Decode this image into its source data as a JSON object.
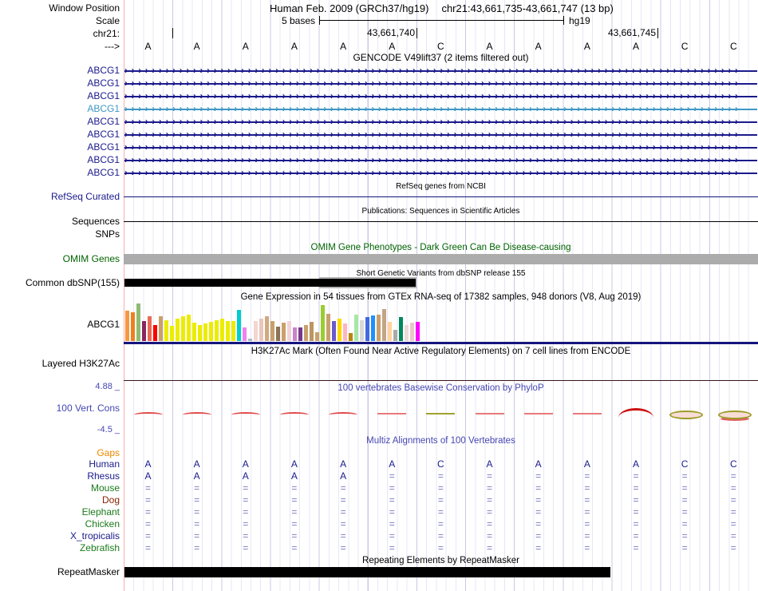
{
  "header": {
    "window_position_label": "Window Position",
    "assembly_title": "Human Feb. 2009 (GRCh37/hg19)",
    "range_title": "chr21:43,661,735-43,661,747 (13 bp)",
    "scale_label": "Scale",
    "scale_value": "5 bases",
    "assembly_tag": "hg19",
    "chrom_label": "chr21:",
    "coord_label_1": "43,661,740",
    "coord_label_2": "43,661,745",
    "strand_label": "--->"
  },
  "sequence": {
    "bases": [
      "A",
      "A",
      "A",
      "A",
      "A",
      "A",
      "C",
      "A",
      "A",
      "A",
      "A",
      "C",
      "C"
    ]
  },
  "gencode": {
    "title": "GENCODE V49lift37 (2 items filtered out)",
    "gene_rows": [
      {
        "label": "ABCG1",
        "color": "#1A1A8C"
      },
      {
        "label": "ABCG1",
        "color": "#1A1A8C"
      },
      {
        "label": "ABCG1",
        "color": "#1A1A8C"
      },
      {
        "label": "ABCG1",
        "color": "#3E97C5"
      },
      {
        "label": "ABCG1",
        "color": "#1A1A8C"
      },
      {
        "label": "ABCG1",
        "color": "#1A1A8C"
      },
      {
        "label": "ABCG1",
        "color": "#1A1A8C"
      },
      {
        "label": "ABCG1",
        "color": "#1A1A8C"
      },
      {
        "label": "ABCG1",
        "color": "#1A1A8C"
      }
    ]
  },
  "refseq": {
    "title": "RefSeq genes from NCBI",
    "label": "RefSeq Curated"
  },
  "publications": {
    "title": "Publications: Sequences in Scientific Articles",
    "label": "Sequences"
  },
  "snps": {
    "label": "SNPs"
  },
  "omim": {
    "title": "OMIM Gene Phenotypes - Dark Green Can Be Disease-causing",
    "label": "OMIM Genes"
  },
  "dbsnp": {
    "title": "Short Genetic Variants from dbSNP release 155",
    "label": "Common dbSNP(155)"
  },
  "gtex": {
    "label": "ABCG1"
  },
  "h3k27ac": {
    "title": "H3K27Ac Mark (Often Found Near Active Regulatory Elements) on 7 cell lines from ENCODE",
    "label": "Layered H3K27Ac"
  },
  "conservation": {
    "title": "100 vertebrates Basewise Conservation by PhyloP",
    "label": "100 Vert. Cons",
    "max_label": "4.88 _",
    "min_label": "-4.5 _",
    "marks": [
      {
        "base": 0,
        "type": "wave"
      },
      {
        "base": 1,
        "type": "wave"
      },
      {
        "base": 2,
        "type": "wave"
      },
      {
        "base": 3,
        "type": "wave"
      },
      {
        "base": 4,
        "type": "wave"
      },
      {
        "base": 5,
        "type": "line-red"
      },
      {
        "base": 6,
        "type": "line-olive"
      },
      {
        "base": 7,
        "type": "line-red"
      },
      {
        "base": 8,
        "type": "line-red"
      },
      {
        "base": 9,
        "type": "line-red"
      },
      {
        "base": 10,
        "type": "peak-red"
      },
      {
        "base": 11,
        "type": "ellipse-olive"
      },
      {
        "base": 12,
        "type": "ellipse-olive-red"
      }
    ]
  },
  "multiz": {
    "title": "Multiz Alignments of 100 Vertebrates",
    "gaps_label": "Gaps",
    "species": [
      {
        "name": "Human",
        "color": "#1A1A8C",
        "cells": [
          "A",
          "A",
          "A",
          "A",
          "A",
          "A",
          "C",
          "A",
          "A",
          "A",
          "A",
          "C",
          "C"
        ]
      },
      {
        "name": "Rhesus",
        "color": "#1A1A8C",
        "cells": [
          "A",
          "A",
          "A",
          "A",
          "A",
          "=",
          "=",
          "=",
          "=",
          "=",
          "=",
          "=",
          "="
        ]
      },
      {
        "name": "Mouse",
        "color": "#1A7A1A",
        "cells": [
          "=",
          "=",
          "=",
          "=",
          "=",
          "=",
          "=",
          "=",
          "=",
          "=",
          "=",
          "=",
          "="
        ]
      },
      {
        "name": "Dog",
        "color": "#8B2200",
        "cells": [
          "=",
          "=",
          "=",
          "=",
          "=",
          "=",
          "=",
          "=",
          "=",
          "=",
          "=",
          "=",
          "="
        ]
      },
      {
        "name": "Elephant",
        "color": "#1A7A1A",
        "cells": [
          "=",
          "=",
          "=",
          "=",
          "=",
          "=",
          "=",
          "=",
          "=",
          "=",
          "=",
          "=",
          "="
        ]
      },
      {
        "name": "Chicken",
        "color": "#1A7A1A",
        "cells": [
          "=",
          "=",
          "=",
          "=",
          "=",
          "=",
          "=",
          "=",
          "=",
          "=",
          "=",
          "=",
          "="
        ]
      },
      {
        "name": "X_tropicalis",
        "color": "#1A1A8C",
        "cells": [
          "=",
          "=",
          "=",
          "=",
          "=",
          "=",
          "=",
          "=",
          "=",
          "=",
          "=",
          "=",
          "="
        ]
      },
      {
        "name": "Zebrafish",
        "color": "#1A7A1A",
        "cells": [
          "=",
          "=",
          "=",
          "=",
          "=",
          "=",
          "=",
          "=",
          "=",
          "=",
          "=",
          "=",
          "="
        ]
      }
    ]
  },
  "repeatmasker": {
    "title": "Repeating Elements by RepeatMasker",
    "label": "RepeatMasker"
  },
  "chart_data": {
    "type": "bar",
    "title": "Gene Expression in 54 tissues from GTEx RNA-seq of 17382 samples, 948 donors (V8, Aug 2019)",
    "gene_label": "ABCG1",
    "xlabel": "",
    "ylabel": "",
    "ylim": [
      0,
      47
    ],
    "bars": [
      {
        "h": 38,
        "color": "#F79840"
      },
      {
        "h": 36,
        "color": "#EE8020"
      },
      {
        "h": 47,
        "color": "#8FBC73"
      },
      {
        "h": 25,
        "color": "#8B2560"
      },
      {
        "h": 31,
        "color": "#E96A55"
      },
      {
        "h": 20,
        "color": "#FF0000"
      },
      {
        "h": 31,
        "color": "#C9A06C"
      },
      {
        "h": 26,
        "color": "#ECEC00"
      },
      {
        "h": 19,
        "color": "#ECEC00"
      },
      {
        "h": 28,
        "color": "#ECEC00"
      },
      {
        "h": 31,
        "color": "#ECEC00"
      },
      {
        "h": 33,
        "color": "#ECEC00"
      },
      {
        "h": 23,
        "color": "#ECEC00"
      },
      {
        "h": 20,
        "color": "#ECEC00"
      },
      {
        "h": 22,
        "color": "#ECEC00"
      },
      {
        "h": 24,
        "color": "#ECEC00"
      },
      {
        "h": 26,
        "color": "#ECEC00"
      },
      {
        "h": 28,
        "color": "#ECEC00"
      },
      {
        "h": 25,
        "color": "#ECEC00"
      },
      {
        "h": 25,
        "color": "#ECEC00"
      },
      {
        "h": 39,
        "color": "#00CDCD"
      },
      {
        "h": 17,
        "color": "#EE82EE"
      },
      {
        "h": 3,
        "color": "#A8B8C8"
      },
      {
        "h": 25,
        "color": "#F2D6CF"
      },
      {
        "h": 28,
        "color": "#EAC5BC"
      },
      {
        "h": 31,
        "color": "#D0A97E"
      },
      {
        "h": 25,
        "color": "#C9A06C"
      },
      {
        "h": 18,
        "color": "#8B7355"
      },
      {
        "h": 23,
        "color": "#C9A06C"
      },
      {
        "h": 25,
        "color": "#F0D4DA"
      },
      {
        "h": 17,
        "color": "#C884C8"
      },
      {
        "h": 17,
        "color": "#7A378B"
      },
      {
        "h": 20,
        "color": "#C9A06C"
      },
      {
        "h": 24,
        "color": "#BE9460"
      },
      {
        "h": 11,
        "color": "#C9A06C"
      },
      {
        "h": 45,
        "color": "#9ACD32"
      },
      {
        "h": 34,
        "color": "#C9A06C"
      },
      {
        "h": 25,
        "color": "#6A5ACD"
      },
      {
        "h": 28,
        "color": "#FFD700"
      },
      {
        "h": 22,
        "color": "#FFB6C1"
      },
      {
        "h": 10,
        "color": "#B8860B"
      },
      {
        "h": 33,
        "color": "#A6E7A6"
      },
      {
        "h": 26,
        "color": "#D8D8D8"
      },
      {
        "h": 30,
        "color": "#4169E1"
      },
      {
        "h": 32,
        "color": "#1E90FF"
      },
      {
        "h": 33,
        "color": "#C9A06C"
      },
      {
        "h": 40,
        "color": "#C4A484"
      },
      {
        "h": 24,
        "color": "#FFD39B"
      },
      {
        "h": 14,
        "color": "#A9A9A9"
      },
      {
        "h": 30,
        "color": "#00885C"
      },
      {
        "h": 20,
        "color": "#F0D8D8"
      },
      {
        "h": 23,
        "color": "#EAC8C8"
      },
      {
        "h": 24,
        "color": "#FF00FF"
      }
    ]
  },
  "colors": {
    "navy": "#1A1A8C",
    "light_blue_gene": "#3E97C5",
    "omim_green": "#006400",
    "species_green": "#1A7A1A",
    "species_dark_red": "#8B2200",
    "cons_blue": "#4646B4",
    "gaps_orange": "#EE8800",
    "equals_blue": "#7878BE",
    "omim_gray": "#ACACAC",
    "dbsnp_gray": "#B4B4B4",
    "grid_light": "#E7E7F6",
    "grid_dark": "#C9C9E6",
    "left_boundary_pink": "#F7AFAF",
    "gtex_baseline_navy": "#15157E",
    "h3k_baseline_maroon": "#381818"
  }
}
